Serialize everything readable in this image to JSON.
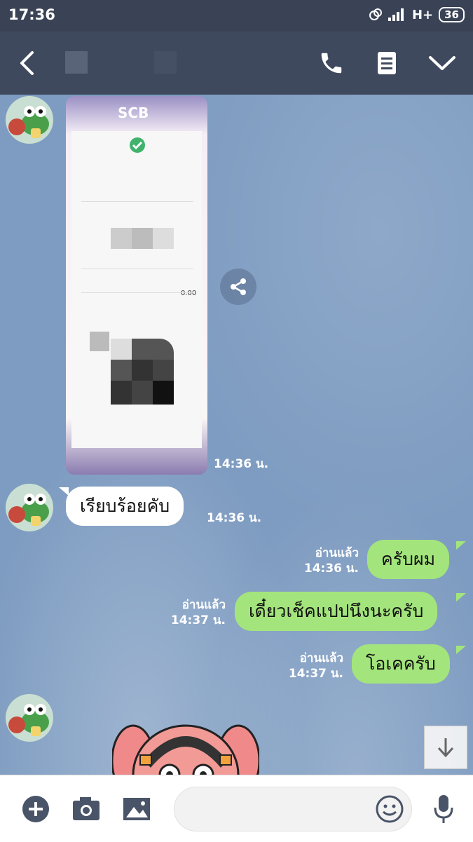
{
  "status_bar": {
    "time": "17:36",
    "network": "H+",
    "battery": "36"
  },
  "header": {
    "back_icon": "back-arrow-icon",
    "call_icon": "phone-icon",
    "notes_icon": "notes-icon",
    "menu_icon": "chevron-down-icon"
  },
  "messages": {
    "image": {
      "logo_text": "SCB",
      "amount_text": "0.00",
      "time": "14:36 น."
    },
    "in_text": {
      "text": "เรียบร้อยคับ",
      "time": "14:36 น."
    },
    "out1": {
      "text": "ครับผม",
      "read": "อ่านแล้ว",
      "time": "14:36 น."
    },
    "out2": {
      "text": "เดี๋ยวเช็คแปปนึงนะครับ",
      "read": "อ่านแล้ว",
      "time": "14:37 น."
    },
    "out3": {
      "text": "โอเคครับ",
      "read": "อ่านแล้ว",
      "time": "14:37 น."
    }
  },
  "input_bar": {
    "placeholder": ""
  },
  "colors": {
    "header": "#3f495e",
    "chat_bg": "#7e9cc1",
    "outgoing_bubble": "#a3e57c",
    "incoming_bubble": "#ffffff"
  }
}
